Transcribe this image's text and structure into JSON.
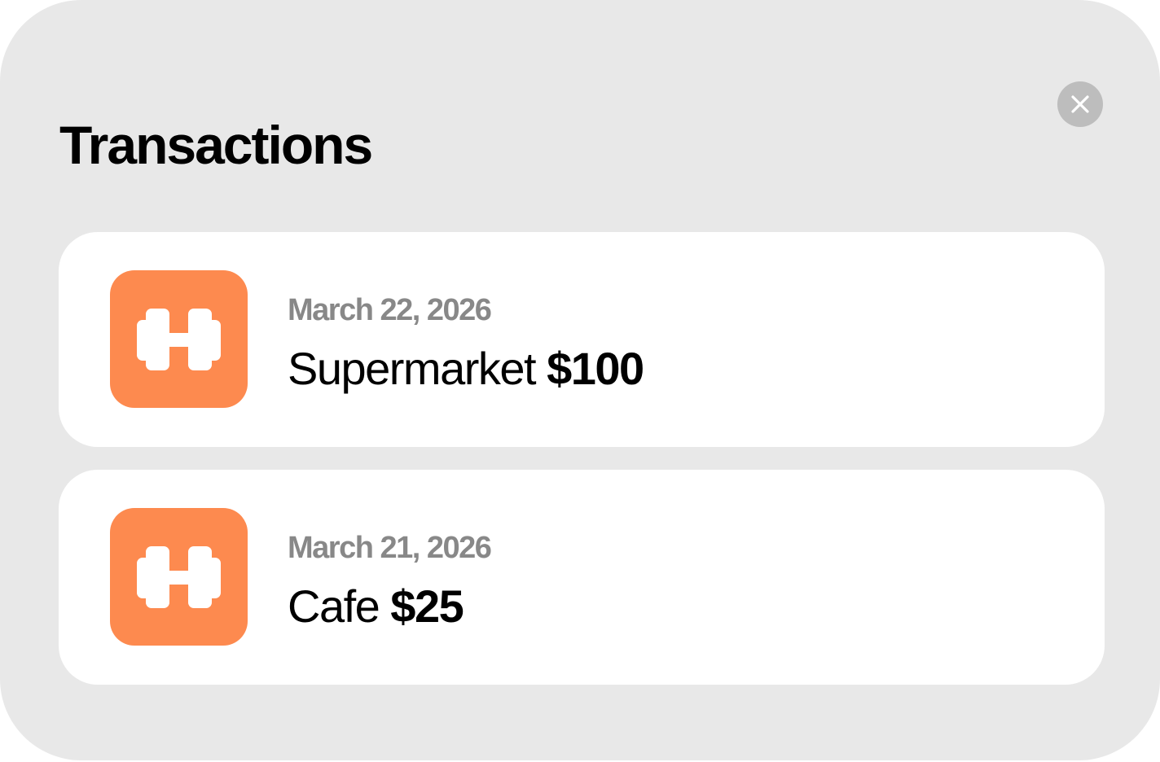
{
  "header": {
    "title": "Transactions",
    "close_icon": "close-icon"
  },
  "colors": {
    "panel_background": "#e8e8e8",
    "card_background": "#ffffff",
    "icon_accent": "#fd8a4f",
    "date_text": "#888888",
    "close_button": "#bdbdbd"
  },
  "transactions": [
    {
      "date": "March 22, 2026",
      "name": "Supermarket",
      "amount": "$100",
      "icon": "dumbbell-icon"
    },
    {
      "date": "March 21, 2026",
      "name": "Cafe",
      "amount": "$25",
      "icon": "dumbbell-icon"
    }
  ]
}
